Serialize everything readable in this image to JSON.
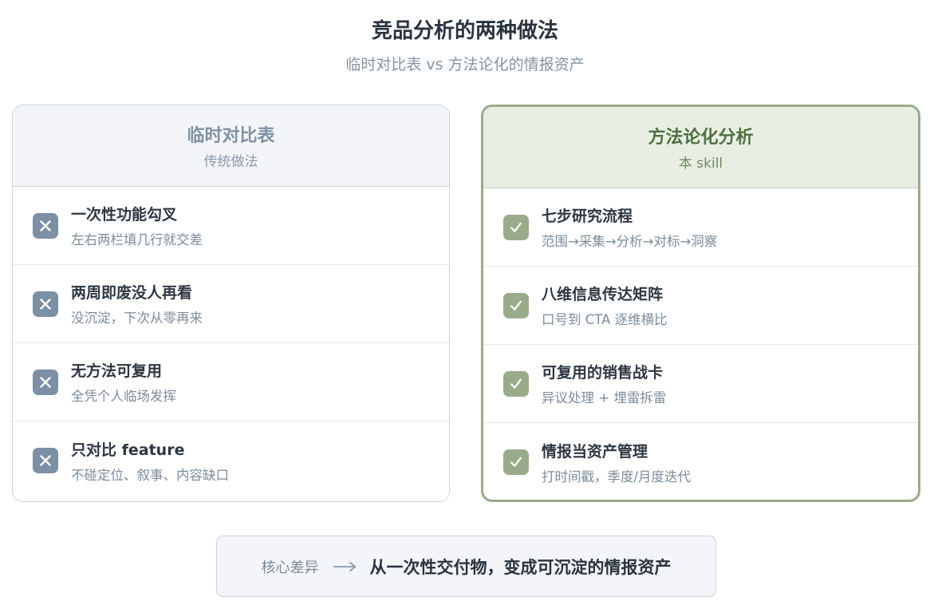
{
  "header": {
    "title": "竞品分析的两种做法",
    "subtitle": "临时对比表 vs 方法论化的情报资产"
  },
  "left_card": {
    "title": "临时对比表",
    "subtitle": "传统做法",
    "icon": "x-icon",
    "items": [
      {
        "title": "一次性功能勾叉",
        "desc": "左右两栏填几行就交差"
      },
      {
        "title": "两周即废没人再看",
        "desc": "没沉淀，下次从零再来"
      },
      {
        "title": "无方法可复用",
        "desc": "全凭个人临场发挥"
      },
      {
        "title": "只对比 feature",
        "desc": "不碰定位、叙事、内容缺口"
      }
    ]
  },
  "right_card": {
    "title": "方法论化分析",
    "subtitle": "本 skill",
    "icon": "check-icon",
    "items": [
      {
        "title": "七步研究流程",
        "desc": "范围→采集→分析→对标→洞察"
      },
      {
        "title": "八维信息传达矩阵",
        "desc": "口号到 CTA 逐维横比"
      },
      {
        "title": "可复用的销售战卡",
        "desc": "异议处理 + 埋雷拆雷"
      },
      {
        "title": "情报当资产管理",
        "desc": "打时间戳，季度/月度迭代"
      }
    ]
  },
  "footer": {
    "label": "核心差异",
    "arrow_icon": "long-arrow-right-icon",
    "message": "从一次性交付物，变成可沉淀的情报资产"
  },
  "colors": {
    "left_accent": "#7b8fa5",
    "right_accent": "#9aab8a",
    "right_title": "#4f7040"
  }
}
